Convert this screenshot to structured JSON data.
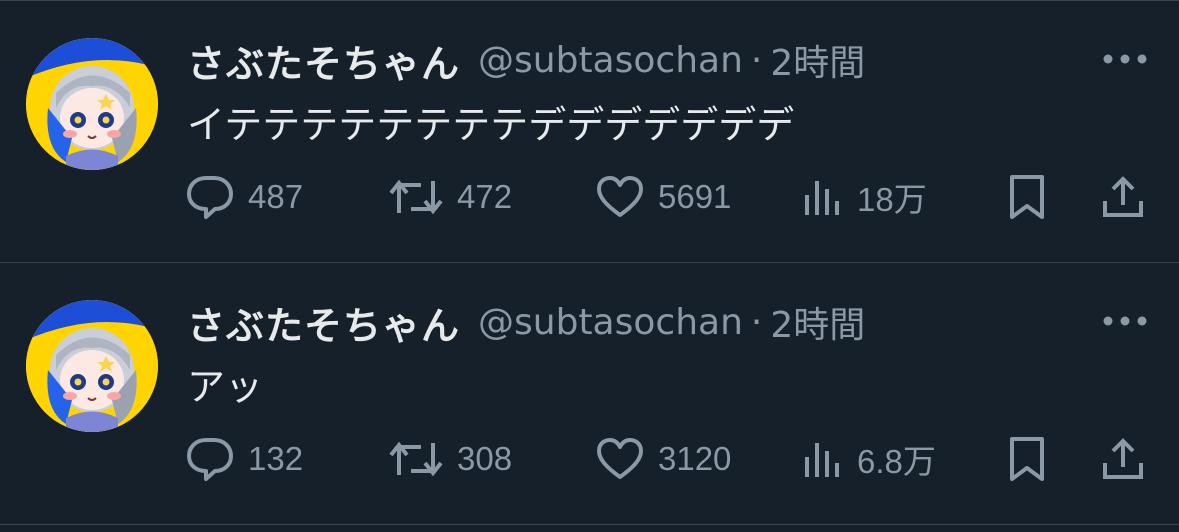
{
  "tweets": [
    {
      "display_name": "さぶたそちゃん",
      "handle": "@subtasochan",
      "separator": "·",
      "time": "2時間",
      "text": "イテテテテテテテテデデデデデデデ",
      "replies": "487",
      "retweets": "472",
      "likes": "5691",
      "views": "18万"
    },
    {
      "display_name": "さぶたそちゃん",
      "handle": "@subtasochan",
      "separator": "·",
      "time": "2時間",
      "text": "アッ",
      "replies": "132",
      "retweets": "308",
      "likes": "3120",
      "views": "6.8万"
    }
  ],
  "icons": {
    "reply": "reply-icon",
    "retweet": "retweet-icon",
    "like": "heart-icon",
    "views": "views-icon",
    "bookmark": "bookmark-icon",
    "share": "share-icon",
    "more": "more-icon"
  },
  "colors": {
    "background": "#15202b",
    "text": "#e7e9ea",
    "secondary": "#8b98a5",
    "divider": "#38444d",
    "avatar_ring": "#ffd400"
  }
}
